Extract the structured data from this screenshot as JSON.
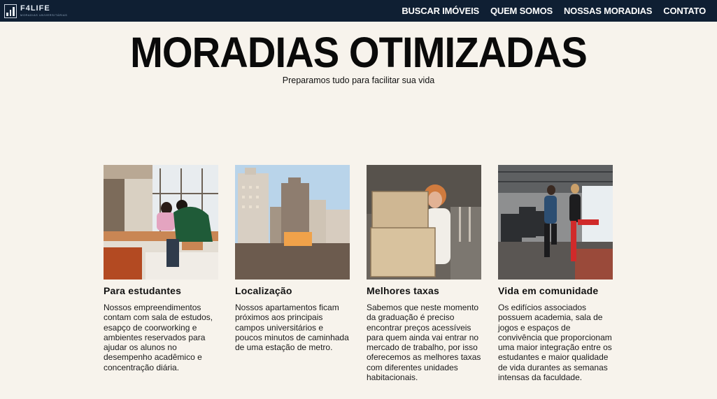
{
  "header": {
    "logo_name": "F4LIFE",
    "logo_tagline": "MORADIAS UNIVERSITÁRIAS",
    "nav": [
      {
        "label": "BUSCAR IMÓVEIS"
      },
      {
        "label": "QUEM SOMOS"
      },
      {
        "label": "NOSSAS MORADIAS"
      },
      {
        "label": "CONTATO"
      }
    ]
  },
  "hero": {
    "title": "MORADIAS OTIMIZADAS",
    "subtitle": "Preparamos tudo para facilitar sua vida"
  },
  "features": [
    {
      "title": "Para estudantes",
      "text": "Nossos empreendimentos contam com sala de estudos, esapço de coorworking e ambientes reservados para ajudar os alunos no desempenho acadêmico e concentração diária."
    },
    {
      "title": "Localização",
      "text": "Nossos apartamentos ficam próximos aos principais campos universitários e poucos minutos de caminhada de uma estação de metro."
    },
    {
      "title": "Melhores taxas",
      "text": "Sabemos que neste momento da graduação é preciso encontrar preços acessíveis para quem ainda vai entrar no mercado de trabalho, por isso oferecemos as melhores taxas com diferentes unidades habitacionais."
    },
    {
      "title": "Vida em comunidade",
      "text": "Os edifícios associados possuem academia, sala de jogos e espaços de convivência que proporcionam uma maior integração entre os estudantes e maior qualidade de vida durantes as semanas intensas da faculdade."
    }
  ],
  "colors": {
    "topbar": "#0f1f33",
    "background": "#f7f3ec"
  }
}
